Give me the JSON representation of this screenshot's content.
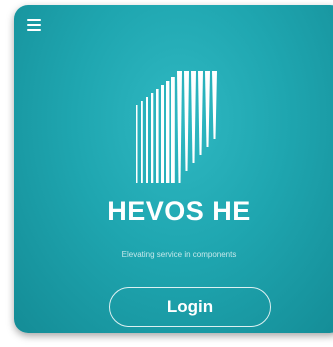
{
  "app": {
    "brand_name": "HEVOS HE",
    "tagline": "Elevating service in components"
  },
  "header": {
    "menu_icon": "hamburger-menu-icon"
  },
  "logo": {
    "icon": "vertical-stripes-logo",
    "color": "#ffffff"
  },
  "actions": {
    "login_label": "Login"
  },
  "colors": {
    "background": "#1fa6b0",
    "text": "#ffffff"
  }
}
